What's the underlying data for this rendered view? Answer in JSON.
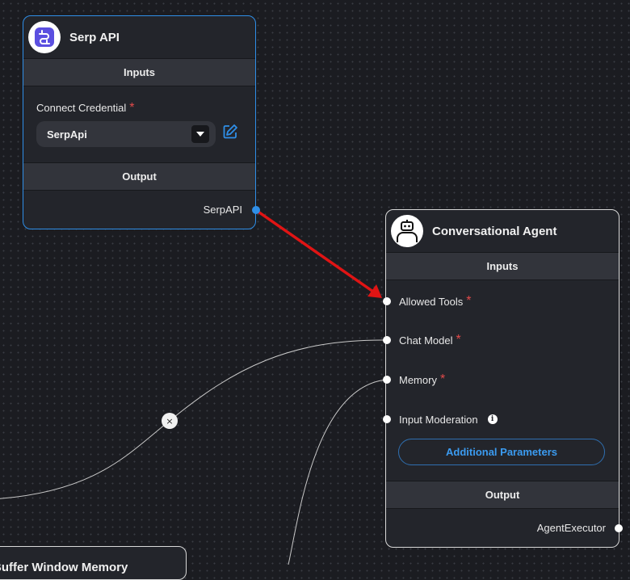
{
  "serp_node": {
    "title": "Serp API",
    "inputs_label": "Inputs",
    "credential_label": "Connect Credential",
    "required_mark": "*",
    "credential_value": "SerpApi",
    "output_label": "Output",
    "output_name": "SerpAPI"
  },
  "agent_node": {
    "title": "Conversational Agent",
    "inputs_label": "Inputs",
    "params": [
      {
        "label": "Allowed Tools",
        "required": "*"
      },
      {
        "label": "Chat Model",
        "required": "*"
      },
      {
        "label": "Memory",
        "required": "*"
      },
      {
        "label": "Input Moderation",
        "info": "i"
      }
    ],
    "additional_params_label": "Additional Parameters",
    "output_label": "Output",
    "output_name": "AgentExecutor"
  },
  "buffer_node": {
    "title": "Buffer Window Memory"
  },
  "edge_delete_label": "×",
  "colors": {
    "canvas": "#1b1c21",
    "node": "#23252b",
    "section": "#32343b",
    "accent_blue": "#2f8fe8",
    "required_red": "#e24a4a",
    "arrow_red": "#e01414",
    "serp_logo": "#5b4fe0"
  },
  "icons": {
    "serp": "serp-api-logo-icon",
    "agent": "robot-icon",
    "edit": "edit-pencil-icon",
    "dropdown": "caret-down-icon",
    "info": "info-icon"
  }
}
